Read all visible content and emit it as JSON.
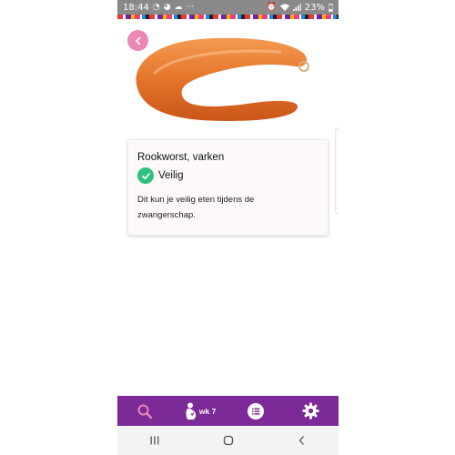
{
  "status_bar": {
    "time": "18:44",
    "battery": "23%",
    "left_icons": [
      "whatsapp-icon",
      "chat-icon",
      "cloud-icon",
      "more-dots-icon"
    ],
    "right_icons": [
      "alarm-icon",
      "wifi-icon",
      "signal-icon",
      "battery-icon"
    ]
  },
  "hero": {
    "image": "smoked-sausage-photo"
  },
  "product": {
    "name": "Rookworst, varken",
    "status": "Veilig",
    "description": "Dit kun je veilig eten tijdens de zwangerschap.",
    "status_color": "#2ec27e"
  },
  "bottom_nav": {
    "week_label": "wk 7",
    "items": [
      "search-icon",
      "pregnancy-week-icon",
      "list-icon",
      "settings-gear-icon"
    ],
    "color": "#7b2a97"
  },
  "system_nav": [
    "recent-apps-icon",
    "home-icon",
    "back-icon"
  ]
}
